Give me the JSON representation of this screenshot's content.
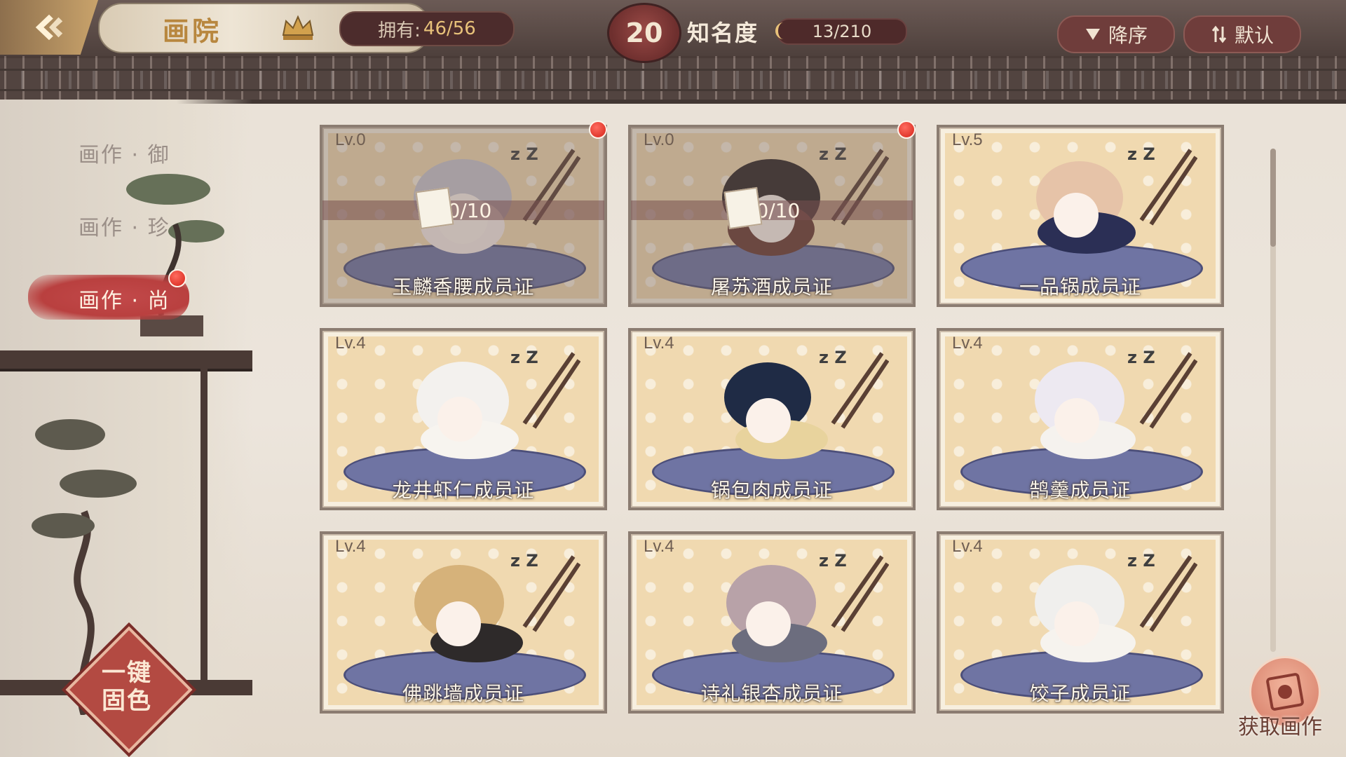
{
  "header": {
    "title": "画院",
    "own_label": "拥有:",
    "own_value": "46/56",
    "fame_level": "20",
    "fame_label": "知名度",
    "fame_progress": "13/210",
    "sort_desc_label": "降序",
    "sort_default_label": "默认"
  },
  "sidebar": {
    "items": [
      {
        "label": "画作 · 御",
        "active": false
      },
      {
        "label": "画作 · 珍",
        "active": false
      },
      {
        "label": "画作 · 尚",
        "active": true
      }
    ],
    "onekey_label_1": "一键",
    "onekey_label_2": "固色"
  },
  "cards": [
    {
      "level": "Lv.0",
      "name": "玉麟香腰成员证",
      "progress": "10/10",
      "new": true
    },
    {
      "level": "Lv.0",
      "name": "屠苏酒成员证",
      "progress": "10/10",
      "new": true
    },
    {
      "level": "Lv.5",
      "name": "一品锅成员证"
    },
    {
      "level": "Lv.4",
      "name": "龙井虾仁成员证"
    },
    {
      "level": "Lv.4",
      "name": "锅包肉成员证"
    },
    {
      "level": "Lv.4",
      "name": "鹄羹成员证"
    },
    {
      "level": "Lv.4",
      "name": "佛跳墙成员证"
    },
    {
      "level": "Lv.4",
      "name": "诗礼银杏成员证"
    },
    {
      "level": "Lv.4",
      "name": "饺子成员证"
    }
  ],
  "get_button_label": "获取画作",
  "colors": {
    "accent_red": "#b9403f",
    "gold": "#e8c27a",
    "notify_dot": "#d42419"
  },
  "icons": {
    "back": "back-arrow-icon",
    "crown": "crown-icon",
    "sort": "triangle-down-icon",
    "default": "swap-arrows-icon",
    "get": "painting-icon"
  }
}
